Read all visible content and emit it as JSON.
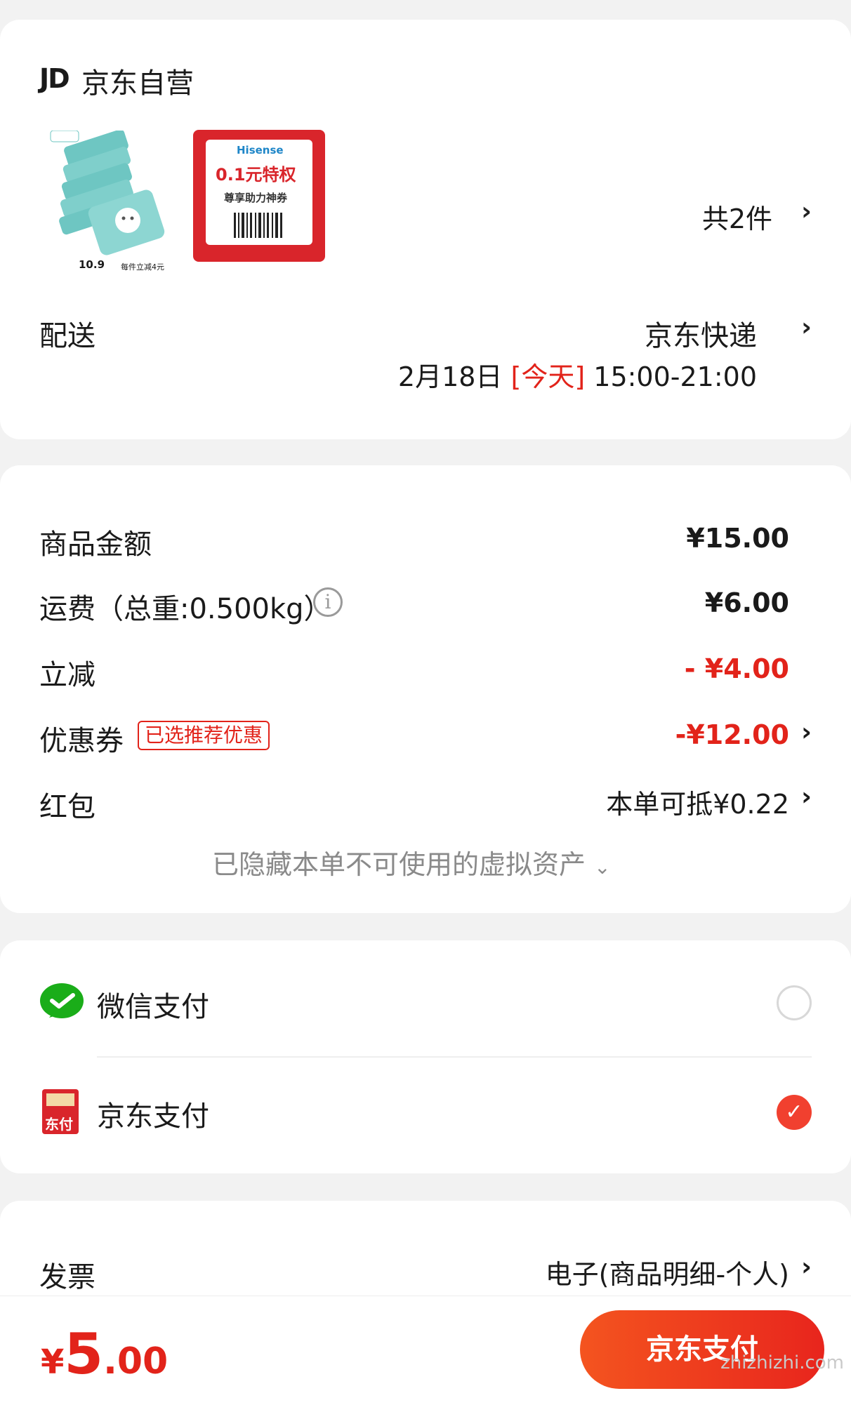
{
  "store": {
    "logo_text": "JD",
    "name": "京东自营"
  },
  "products": {
    "item1": {
      "price": "10.9",
      "badge": "每件立减4元"
    },
    "item2": {
      "brand": "Hisense",
      "headline": "0.1元特权",
      "subline": "尊享助力神券"
    },
    "count_label": "共2件"
  },
  "delivery": {
    "label": "配送",
    "method": "京东快递",
    "date": "2月18日",
    "today_tag": "[今天]",
    "time_window": "15:00-21:00"
  },
  "pricing": {
    "goods_label": "商品金额",
    "goods_value": "¥15.00",
    "shipping_label": "运费（总重:0.500kg）",
    "shipping_value": "¥6.00",
    "discount_label": "立减",
    "discount_value": "- ¥4.00",
    "coupon_label": "优惠券",
    "coupon_tag": "已选推荐优惠",
    "coupon_value": "-¥12.00",
    "redpacket_label": "红包",
    "redpacket_value": "本单可抵¥0.22",
    "hidden_assets": "已隐藏本单不可使用的虚拟资产"
  },
  "payment": {
    "wechat_label": "微信支付",
    "jdpay_label": "京东支付",
    "jdpay_icon_text": "东付",
    "selected": "jdpay"
  },
  "invoice": {
    "label": "发票",
    "value": "电子(商品明细-个人)"
  },
  "footer": {
    "currency": "¥",
    "total_int": "5",
    "total_dec": ".00",
    "pay_button": "京东支付",
    "watermark": "zhizhizhi.com"
  },
  "colors": {
    "accent": "#e2231a",
    "button_start": "#f4541f",
    "button_end": "#e8251d",
    "wechat": "#1aad19"
  }
}
